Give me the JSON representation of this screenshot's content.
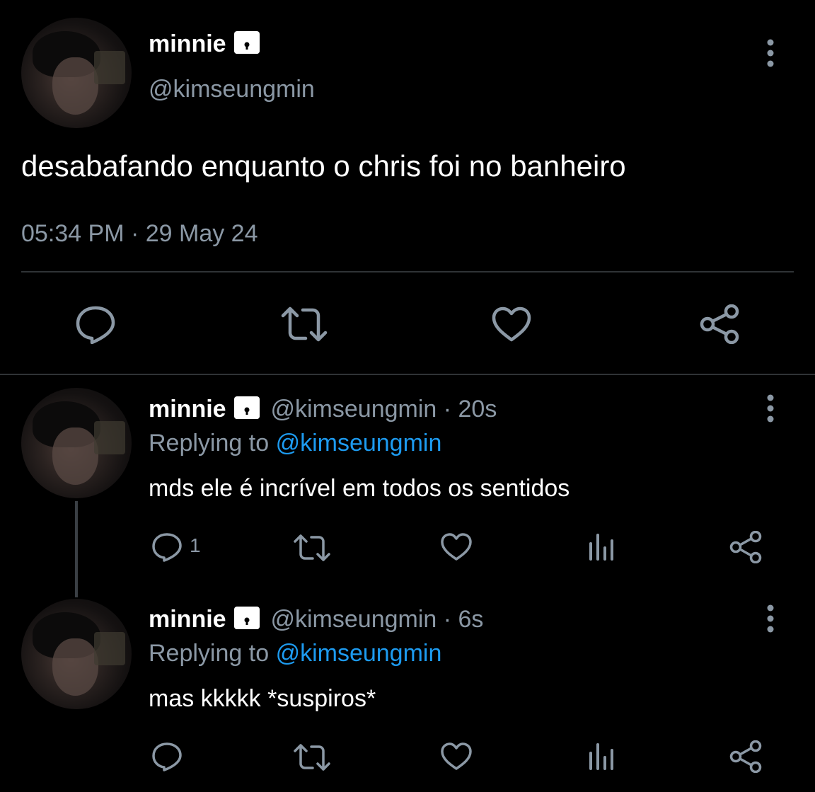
{
  "main_tweet": {
    "name": "minnie",
    "handle": "@kimseungmin",
    "text": "desabafando enquanto o chris foi no banheiro",
    "timestamp": "05:34 PM · 29 May 24",
    "icons": [
      "reply-icon",
      "retweet-icon",
      "like-icon",
      "share-icon"
    ]
  },
  "replies": [
    {
      "name": "minnie",
      "handle": "@kimseungmin",
      "age": "· 20s",
      "replying_label": "Replying to",
      "replying_to": "@kimseungmin",
      "text": "mds ele é incrível em todos os sentidos",
      "reply_count": "1"
    },
    {
      "name": "minnie",
      "handle": "@kimseungmin",
      "age": "· 6s",
      "replying_label": "Replying to",
      "replying_to": "@kimseungmin",
      "text": "mas kkkkk *suspiros*",
      "reply_count": ""
    }
  ],
  "colors": {
    "background": "#000000",
    "muted": "#8b98a5",
    "link": "#1d9bf0",
    "divider": "#2f3336"
  }
}
